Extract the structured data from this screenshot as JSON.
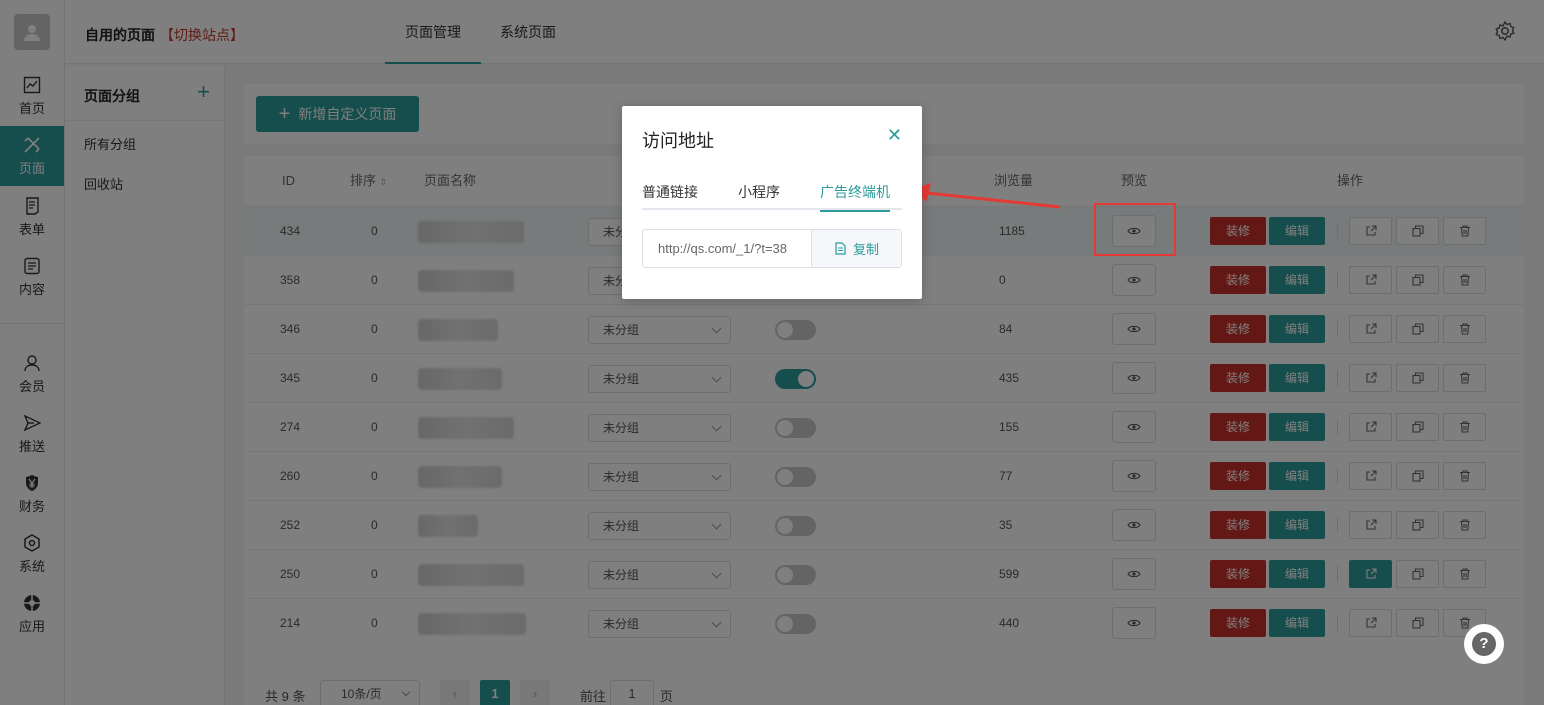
{
  "rail": {
    "items": [
      {
        "label": "首页",
        "icon": "chart-icon"
      },
      {
        "label": "页面",
        "icon": "design-icon"
      },
      {
        "label": "表单",
        "icon": "form-icon"
      },
      {
        "label": "内容",
        "icon": "content-icon"
      },
      {
        "label": "会员",
        "icon": "user-icon"
      },
      {
        "label": "推送",
        "icon": "send-icon"
      },
      {
        "label": "财务",
        "icon": "yen-icon"
      },
      {
        "label": "系统",
        "icon": "system-icon"
      },
      {
        "label": "应用",
        "icon": "app-icon"
      }
    ]
  },
  "header": {
    "site_name": "自用的页面",
    "switch_site": "【切换站点】",
    "tabs": [
      "页面管理",
      "系统页面"
    ]
  },
  "groups": {
    "title": "页面分组",
    "items": [
      "所有分组",
      "回收站"
    ]
  },
  "toolbar": {
    "new_label": "新增自定义页面"
  },
  "table": {
    "columns": {
      "id": "ID",
      "sort": "排序",
      "name": "页面名称",
      "views": "浏览量",
      "preview": "预览",
      "actions": "操作"
    },
    "rows": [
      {
        "id": "434",
        "sort": "0",
        "group": "未分组",
        "enabled": false,
        "views": "1185"
      },
      {
        "id": "358",
        "sort": "0",
        "group": "未分组",
        "enabled": false,
        "views": "0"
      },
      {
        "id": "346",
        "sort": "0",
        "group": "未分组",
        "enabled": false,
        "views": "84"
      },
      {
        "id": "345",
        "sort": "0",
        "group": "未分组",
        "enabled": true,
        "views": "435"
      },
      {
        "id": "274",
        "sort": "0",
        "group": "未分组",
        "enabled": false,
        "views": "155"
      },
      {
        "id": "260",
        "sort": "0",
        "group": "未分组",
        "enabled": false,
        "views": "77"
      },
      {
        "id": "252",
        "sort": "0",
        "group": "未分组",
        "enabled": false,
        "views": "35"
      },
      {
        "id": "250",
        "sort": "0",
        "group": "未分组",
        "enabled": false,
        "views": "599"
      },
      {
        "id": "214",
        "sort": "0",
        "group": "未分组",
        "enabled": false,
        "views": "440"
      }
    ],
    "decorate_label": "装修",
    "edit_label": "编辑"
  },
  "pager": {
    "total": "共 9 条",
    "page_size": "10条/页",
    "current_page": "1",
    "goto_prefix": "前往",
    "goto_value": "1",
    "goto_suffix": "页"
  },
  "dialog": {
    "title": "访问地址",
    "tabs": [
      "普通链接",
      "小程序",
      "广告终端机"
    ],
    "active_tab": "广告终端机",
    "url": "http://qs.com/_1/?t=38",
    "copy_label": "复制"
  },
  "colors": {
    "accent": "#2a9c99",
    "danger": "#c9302c",
    "annotation": "#e53935"
  }
}
